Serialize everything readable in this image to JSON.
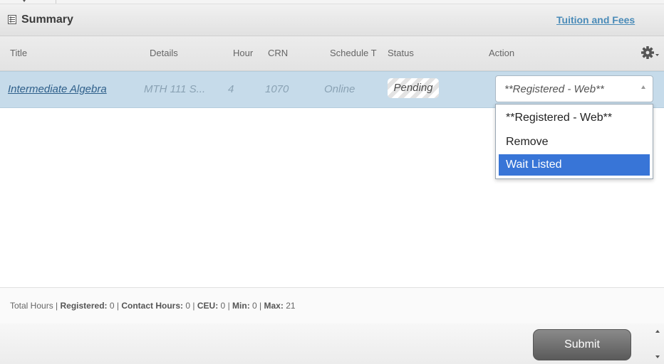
{
  "header": {
    "title": "Summary",
    "link_label": "Tuition and Fees",
    "icon": "list-icon"
  },
  "columns": {
    "title": "Title",
    "details": "Details",
    "hour": "Hour",
    "crn": "CRN",
    "schedule": "Schedule T",
    "status": "Status",
    "action": "Action",
    "settings_icon": "gear-icon"
  },
  "row": {
    "title": "Intermediate Algebra",
    "details": "MTH 111 S...",
    "hours": "4",
    "crn": "1070",
    "schedule": "Online",
    "status": "Pending",
    "action_value": "**Registered - Web**"
  },
  "action_options": [
    "**Registered - Web**",
    "Remove",
    "Wait Listed"
  ],
  "action_highlighted": "Wait Listed",
  "totals": {
    "label": "Total Hours |",
    "registered_label": "Registered:",
    "registered": "0",
    "contact_label": "Contact Hours:",
    "contact": "0",
    "ceu_label": "CEU:",
    "ceu": "0",
    "min_label": "Min:",
    "min": "0",
    "max_label": "Max:",
    "max": "21"
  },
  "footer": {
    "submit_label": "Submit"
  },
  "colors": {
    "selected_row": "#c6dbea",
    "highlight_option": "#3875d7",
    "link": "#4a8bb8"
  }
}
